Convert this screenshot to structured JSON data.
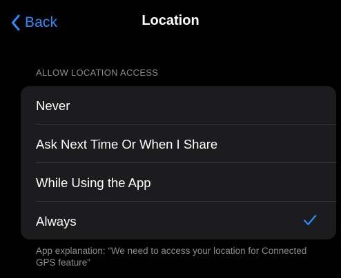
{
  "nav": {
    "back_label": "Back",
    "title": "Location",
    "back_icon": "chevron-left-icon"
  },
  "section": {
    "header": "ALLOW LOCATION ACCESS",
    "options": [
      {
        "label": "Never",
        "selected": false
      },
      {
        "label": "Ask Next Time Or When I Share",
        "selected": false
      },
      {
        "label": "While Using the App",
        "selected": false
      },
      {
        "label": "Always",
        "selected": true
      }
    ],
    "selected_icon": "checkmark-icon",
    "footer": "App explanation: “We need to access your location for Connected GPS feature”"
  },
  "colors": {
    "background": "#000000",
    "group_background": "#1c1c1e",
    "accent": "#2f8bff",
    "secondary_text": "#8d8d93",
    "divider": "#38383a"
  }
}
